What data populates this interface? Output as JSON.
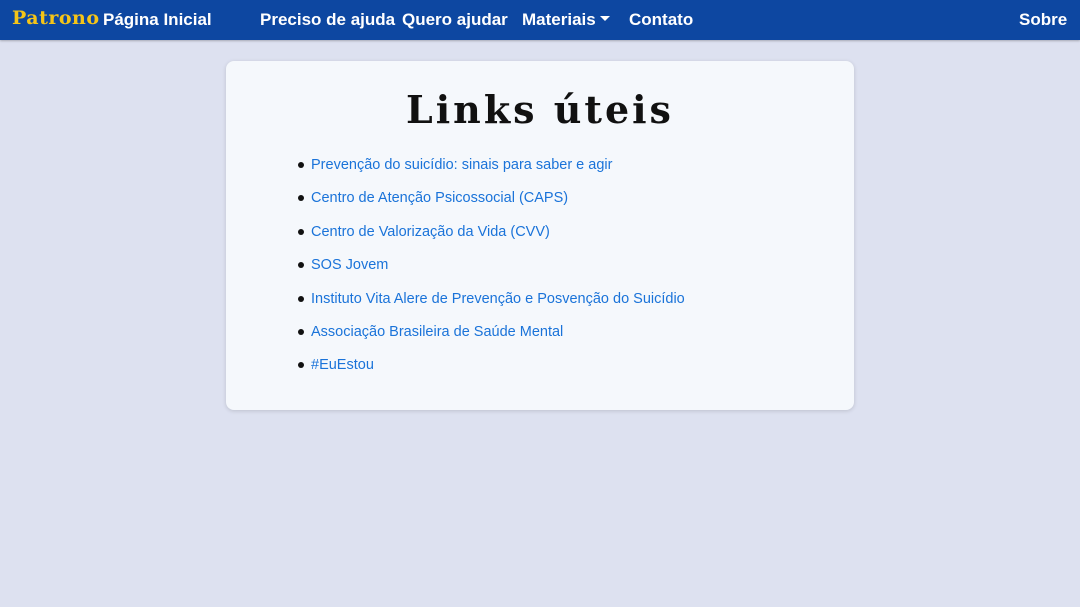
{
  "navbar": {
    "brand": "Patrono",
    "home": "Página Inicial",
    "need_help": "Preciso de ajuda",
    "want_help": "Quero ajudar",
    "materials": "Materiais",
    "contact": "Contato",
    "about": "Sobre",
    "bg_color": "#0d47a1",
    "brand_color": "#f5c518"
  },
  "page": {
    "title": "Links úteis",
    "bg_color": "#dde1f0"
  },
  "links": [
    "Prevenção do suicídio: sinais para saber e agir",
    "Centro de Atenção Psicossocial (CAPS)",
    "Centro de Valorização da Vida (CVV)",
    "SOS Jovem",
    "Instituto Vita Alere de Prevenção e Posvenção do Suicídio",
    "Associação Brasileira de Saúde Mental",
    "#EuEstou"
  ],
  "link_color": "#1a73d9"
}
